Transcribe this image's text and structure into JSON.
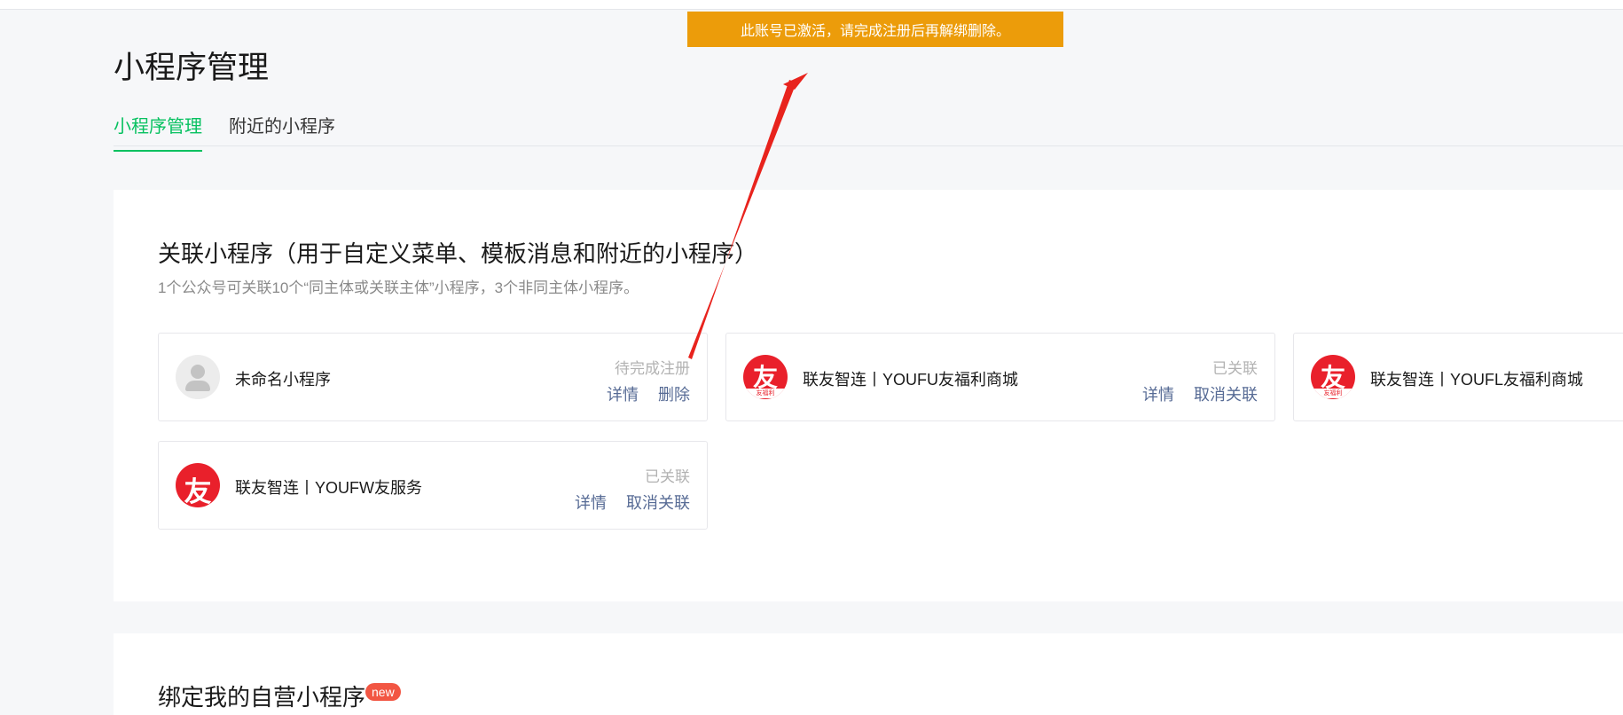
{
  "toast": {
    "message": "此账号已激活，请完成注册后再解绑删除。"
  },
  "page": {
    "title": "小程序管理"
  },
  "tabs": [
    {
      "label": "小程序管理",
      "active": true
    },
    {
      "label": "附近的小程序",
      "active": false
    }
  ],
  "section_linked": {
    "title": "关联小程序（用于自定义菜单、模板消息和附近的小程序）",
    "description": "1个公众号可关联10个“同主体或关联主体”小程序，3个非同主体小程序。",
    "cards": [
      {
        "name": "未命名小程序",
        "status": "待完成注册",
        "actions": [
          "详情",
          "删除"
        ],
        "icon": "default-avatar-icon"
      },
      {
        "name": "联友智连丨YOUFU友福利商城",
        "status": "已关联",
        "actions": [
          "详情",
          "取消关联"
        ],
        "icon": "youfu-logo-icon",
        "logo_glyph": "友",
        "logo_sub": "友福利"
      },
      {
        "name": "联友智连丨YOUFL友福利商城",
        "status": "",
        "actions": [],
        "icon": "youfl-logo-icon",
        "logo_glyph": "友",
        "logo_sub": "友福利"
      },
      {
        "name": "联友智连丨YOUFW友服务",
        "status": "已关联",
        "actions": [
          "详情",
          "取消关联"
        ],
        "icon": "youfw-logo-icon",
        "logo_glyph": "友"
      }
    ]
  },
  "section_bind": {
    "title": "绑定我的自营小程序",
    "badge": "new"
  },
  "colors": {
    "accent": "#07c160",
    "toast": "#ec9c0a",
    "link": "#576b95",
    "brand_red": "#e9202b",
    "annotation_arrow": "#e8231d"
  }
}
